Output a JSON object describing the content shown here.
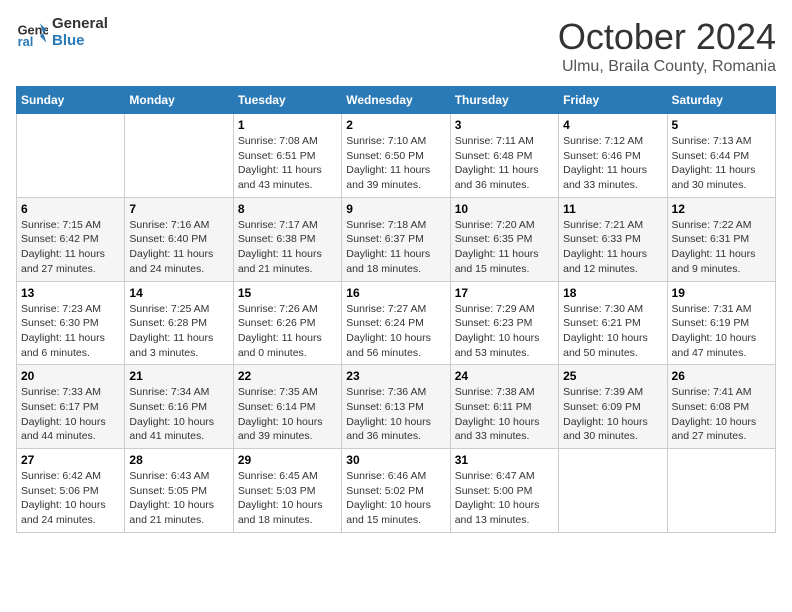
{
  "header": {
    "logo_general": "General",
    "logo_blue": "Blue",
    "month_title": "October 2024",
    "location": "Ulmu, Braila County, Romania"
  },
  "days_of_week": [
    "Sunday",
    "Monday",
    "Tuesday",
    "Wednesday",
    "Thursday",
    "Friday",
    "Saturday"
  ],
  "weeks": [
    [
      {
        "day": "",
        "info": ""
      },
      {
        "day": "",
        "info": ""
      },
      {
        "day": "1",
        "info": "Sunrise: 7:08 AM\nSunset: 6:51 PM\nDaylight: 11 hours and 43 minutes."
      },
      {
        "day": "2",
        "info": "Sunrise: 7:10 AM\nSunset: 6:50 PM\nDaylight: 11 hours and 39 minutes."
      },
      {
        "day": "3",
        "info": "Sunrise: 7:11 AM\nSunset: 6:48 PM\nDaylight: 11 hours and 36 minutes."
      },
      {
        "day": "4",
        "info": "Sunrise: 7:12 AM\nSunset: 6:46 PM\nDaylight: 11 hours and 33 minutes."
      },
      {
        "day": "5",
        "info": "Sunrise: 7:13 AM\nSunset: 6:44 PM\nDaylight: 11 hours and 30 minutes."
      }
    ],
    [
      {
        "day": "6",
        "info": "Sunrise: 7:15 AM\nSunset: 6:42 PM\nDaylight: 11 hours and 27 minutes."
      },
      {
        "day": "7",
        "info": "Sunrise: 7:16 AM\nSunset: 6:40 PM\nDaylight: 11 hours and 24 minutes."
      },
      {
        "day": "8",
        "info": "Sunrise: 7:17 AM\nSunset: 6:38 PM\nDaylight: 11 hours and 21 minutes."
      },
      {
        "day": "9",
        "info": "Sunrise: 7:18 AM\nSunset: 6:37 PM\nDaylight: 11 hours and 18 minutes."
      },
      {
        "day": "10",
        "info": "Sunrise: 7:20 AM\nSunset: 6:35 PM\nDaylight: 11 hours and 15 minutes."
      },
      {
        "day": "11",
        "info": "Sunrise: 7:21 AM\nSunset: 6:33 PM\nDaylight: 11 hours and 12 minutes."
      },
      {
        "day": "12",
        "info": "Sunrise: 7:22 AM\nSunset: 6:31 PM\nDaylight: 11 hours and 9 minutes."
      }
    ],
    [
      {
        "day": "13",
        "info": "Sunrise: 7:23 AM\nSunset: 6:30 PM\nDaylight: 11 hours and 6 minutes."
      },
      {
        "day": "14",
        "info": "Sunrise: 7:25 AM\nSunset: 6:28 PM\nDaylight: 11 hours and 3 minutes."
      },
      {
        "day": "15",
        "info": "Sunrise: 7:26 AM\nSunset: 6:26 PM\nDaylight: 11 hours and 0 minutes."
      },
      {
        "day": "16",
        "info": "Sunrise: 7:27 AM\nSunset: 6:24 PM\nDaylight: 10 hours and 56 minutes."
      },
      {
        "day": "17",
        "info": "Sunrise: 7:29 AM\nSunset: 6:23 PM\nDaylight: 10 hours and 53 minutes."
      },
      {
        "day": "18",
        "info": "Sunrise: 7:30 AM\nSunset: 6:21 PM\nDaylight: 10 hours and 50 minutes."
      },
      {
        "day": "19",
        "info": "Sunrise: 7:31 AM\nSunset: 6:19 PM\nDaylight: 10 hours and 47 minutes."
      }
    ],
    [
      {
        "day": "20",
        "info": "Sunrise: 7:33 AM\nSunset: 6:17 PM\nDaylight: 10 hours and 44 minutes."
      },
      {
        "day": "21",
        "info": "Sunrise: 7:34 AM\nSunset: 6:16 PM\nDaylight: 10 hours and 41 minutes."
      },
      {
        "day": "22",
        "info": "Sunrise: 7:35 AM\nSunset: 6:14 PM\nDaylight: 10 hours and 39 minutes."
      },
      {
        "day": "23",
        "info": "Sunrise: 7:36 AM\nSunset: 6:13 PM\nDaylight: 10 hours and 36 minutes."
      },
      {
        "day": "24",
        "info": "Sunrise: 7:38 AM\nSunset: 6:11 PM\nDaylight: 10 hours and 33 minutes."
      },
      {
        "day": "25",
        "info": "Sunrise: 7:39 AM\nSunset: 6:09 PM\nDaylight: 10 hours and 30 minutes."
      },
      {
        "day": "26",
        "info": "Sunrise: 7:41 AM\nSunset: 6:08 PM\nDaylight: 10 hours and 27 minutes."
      }
    ],
    [
      {
        "day": "27",
        "info": "Sunrise: 6:42 AM\nSunset: 5:06 PM\nDaylight: 10 hours and 24 minutes."
      },
      {
        "day": "28",
        "info": "Sunrise: 6:43 AM\nSunset: 5:05 PM\nDaylight: 10 hours and 21 minutes."
      },
      {
        "day": "29",
        "info": "Sunrise: 6:45 AM\nSunset: 5:03 PM\nDaylight: 10 hours and 18 minutes."
      },
      {
        "day": "30",
        "info": "Sunrise: 6:46 AM\nSunset: 5:02 PM\nDaylight: 10 hours and 15 minutes."
      },
      {
        "day": "31",
        "info": "Sunrise: 6:47 AM\nSunset: 5:00 PM\nDaylight: 10 hours and 13 minutes."
      },
      {
        "day": "",
        "info": ""
      },
      {
        "day": "",
        "info": ""
      }
    ]
  ]
}
